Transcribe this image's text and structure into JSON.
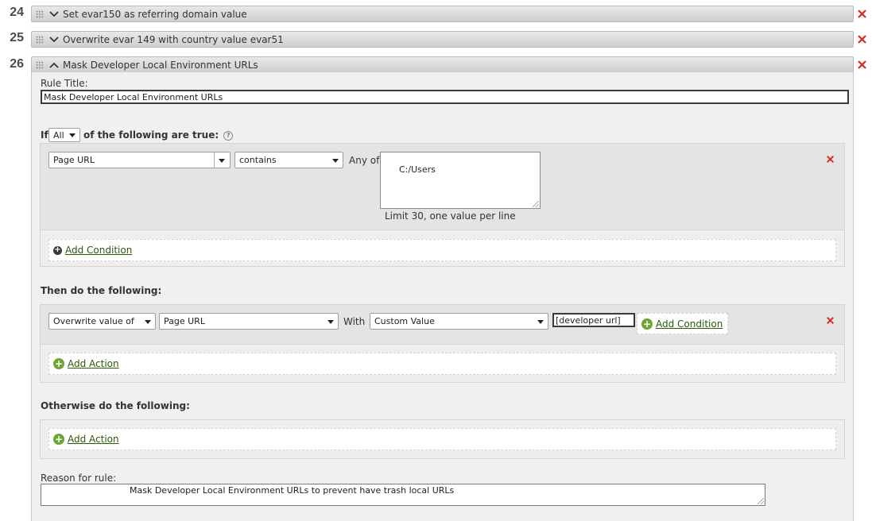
{
  "rules": [
    {
      "number": "24",
      "title": "Set evar150 as referring domain value"
    },
    {
      "number": "25",
      "title": "Overwrite evar 149 with country value evar51"
    },
    {
      "number": "26",
      "title": "Mask Developer Local Environment URLs"
    }
  ],
  "editor": {
    "rule_title_label": "Rule Title:",
    "rule_title_value": "Mask Developer Local Environment URLs",
    "if_label": "If",
    "match_select": "All",
    "following_label": "of the following are true:",
    "help_glyph": "?",
    "condition": {
      "field": "Page URL",
      "operator": "contains",
      "any_of_label": "Any of",
      "values": "C:/Users",
      "limit_hint": "Limit 30, one value per line"
    },
    "add_condition": "Add Condition",
    "then_label": "Then do the following:",
    "action": {
      "verb": "Overwrite value of",
      "target": "Page URL",
      "with_label": "With",
      "source": "Custom Value",
      "custom_value": "[developer url]",
      "add_condition": "Add Condition"
    },
    "add_action": "Add Action",
    "otherwise_label": "Otherwise do the following:",
    "otherwise_add_action": "Add Action",
    "reason_label": "Reason for rule:",
    "reason_value": "Mask Developer Local Environment URLs to prevent have trash local URLs"
  },
  "colors": {
    "delete_red": "#d9261c",
    "link_green": "#2b5a0b",
    "plus_green": "#6da533"
  },
  "icons": [
    "drag-handle-icon",
    "chevron-down-icon",
    "chevron-up-icon",
    "close-icon",
    "plus-circle-icon",
    "help-icon",
    "dropdown-arrow-icon"
  ]
}
